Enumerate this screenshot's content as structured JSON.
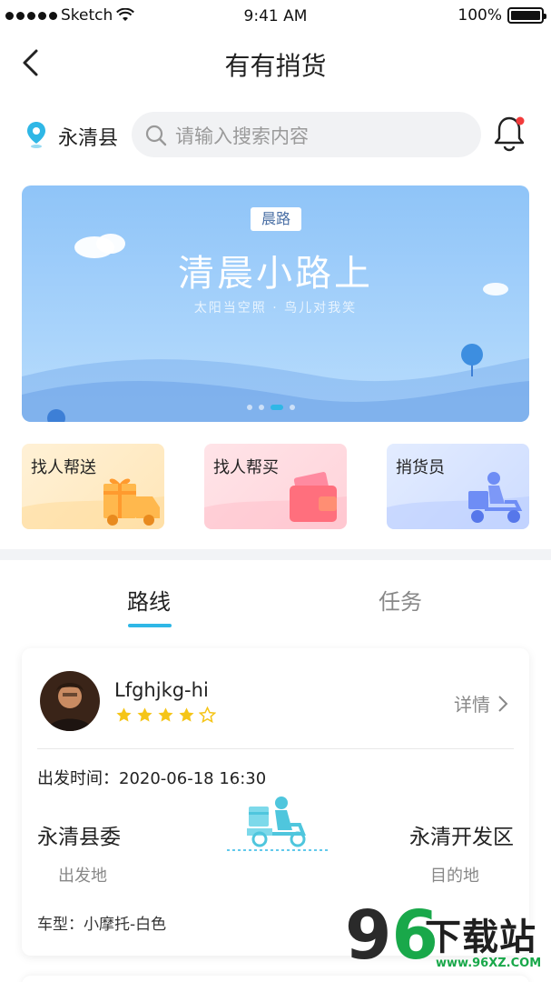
{
  "status_bar": {
    "carrier": "Sketch",
    "time": "9:41 AM",
    "battery": "100%"
  },
  "nav": {
    "title": "有有捎货",
    "back_icon": "chevron-left-icon"
  },
  "search": {
    "location": "永清县",
    "placeholder": "请输入搜索内容",
    "notification_icon": "bell-icon"
  },
  "banner": {
    "tag": "晨路",
    "title": "清晨小路上",
    "subtitle": "太阳当空照 · 鸟儿对我笑",
    "page_count": 4,
    "active_page": 3
  },
  "categories": [
    {
      "label": "找人帮送",
      "icon": "gift-truck-icon"
    },
    {
      "label": "找人帮买",
      "icon": "wallet-icon"
    },
    {
      "label": "捎货员",
      "icon": "courier-scooter-icon"
    }
  ],
  "tabs": [
    {
      "label": "路线",
      "active": true
    },
    {
      "label": "任务",
      "active": false
    }
  ],
  "route_card": {
    "username": "Lfghjkg-hi",
    "rating": 4,
    "rating_max": 5,
    "detail_label": "详情",
    "depart_label": "出发时间：",
    "depart_time": "2020-06-18 16:30",
    "from_place": "永清县委",
    "from_label": "出发地",
    "to_place": "永清开发区",
    "to_label": "目的地",
    "car_type_label": "车型：",
    "car_type": "小摩托-白色"
  },
  "watermark": {
    "nine": "9",
    "six": "6",
    "text": "下载站",
    "url": "www.96XZ.COM"
  },
  "colors": {
    "accent": "#2fb7e6",
    "star": "#f5c518",
    "text": "#222222",
    "muted": "#888888"
  }
}
